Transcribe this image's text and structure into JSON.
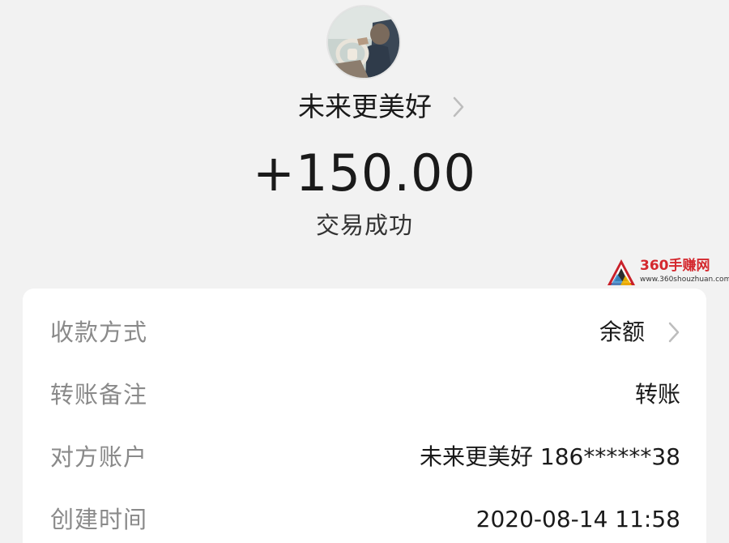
{
  "profile": {
    "avatar_icon": "user-avatar-photo",
    "name": "未来更美好",
    "chevron_icon": "chevron-right-icon"
  },
  "transaction": {
    "amount": "+150.00",
    "status": "交易成功"
  },
  "watermark": {
    "title": "360手赚网",
    "url": "www.360shouzhuan.com"
  },
  "details": {
    "rows": [
      {
        "label": "收款方式",
        "value": "余额",
        "has_chevron": true
      },
      {
        "label": "转账备注",
        "value": "转账",
        "has_chevron": false
      },
      {
        "label": "对方账户",
        "value": "未来更美好 186******38",
        "has_chevron": false
      },
      {
        "label": "创建时间",
        "value": "2020-08-14 11:58",
        "has_chevron": false
      }
    ]
  },
  "colors": {
    "background": "#f2f2f2",
    "card": "#ffffff",
    "label": "#8a8a8a",
    "value": "#1a1a1a",
    "chevron": "#bdbdbd",
    "watermark_red": "#d4282e"
  }
}
